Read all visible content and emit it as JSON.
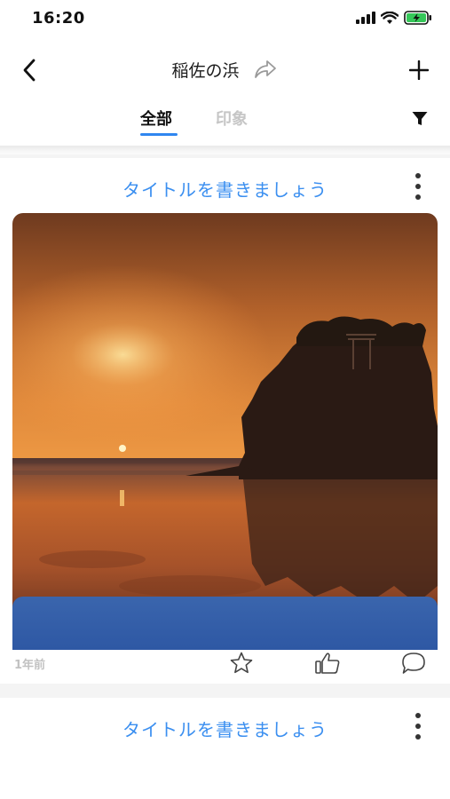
{
  "status_bar": {
    "time": "16:20",
    "icons": [
      "signal-icon",
      "wifi-icon",
      "battery-charging-icon"
    ]
  },
  "nav": {
    "back_icon": "chevron-left-icon",
    "title": "稲佐の浜",
    "share_icon": "share-arrow-icon",
    "add_icon": "plus-icon"
  },
  "tabs": {
    "items": [
      {
        "label": "全部",
        "active": true
      },
      {
        "label": "印象",
        "active": false
      }
    ],
    "filter_icon": "filter-funnel-icon",
    "accent_color": "#2f86f0"
  },
  "feed": {
    "cards": [
      {
        "title": "タイトルを書きましょう",
        "more_icon": "more-vertical-icon",
        "image": "sunset-beach-rock-photo",
        "time_ago": "1年前",
        "actions": [
          "star-icon",
          "thumbs-up-icon",
          "comment-icon"
        ]
      },
      {
        "title": "タイトルを書きましょう",
        "more_icon": "more-vertical-icon",
        "image": "blue-sky-photo"
      }
    ],
    "title_color": "#3b8ff0"
  }
}
